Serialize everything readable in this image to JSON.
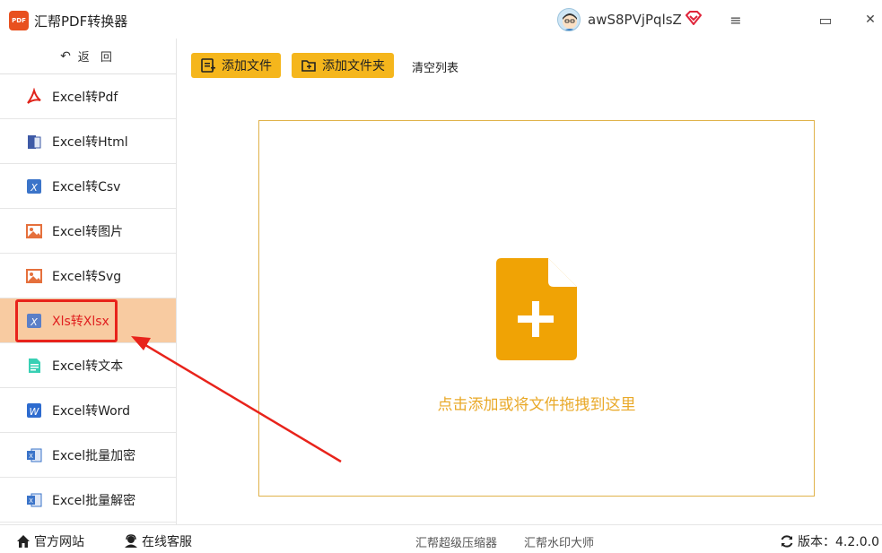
{
  "app": {
    "logo_text": "PDF",
    "title": "汇帮PDF转换器",
    "username": "awS8PVjPqlsZ"
  },
  "window_controls": {
    "menu": "≡",
    "maximize": "▭",
    "close": "✕"
  },
  "sidebar": {
    "back_label": "返 回",
    "items": [
      {
        "label": "Excel转Pdf",
        "icon": "pdf-icon"
      },
      {
        "label": "Excel转Html",
        "icon": "html-icon"
      },
      {
        "label": "Excel转Csv",
        "icon": "csv-icon"
      },
      {
        "label": "Excel转图片",
        "icon": "image-icon"
      },
      {
        "label": "Excel转Svg",
        "icon": "image-icon"
      },
      {
        "label": "Xls转Xlsx",
        "icon": "xls-icon",
        "active": true
      },
      {
        "label": "Excel转文本",
        "icon": "text-icon"
      },
      {
        "label": "Excel转Word",
        "icon": "word-icon"
      },
      {
        "label": "Excel批量加密",
        "icon": "excel-icon"
      },
      {
        "label": "Excel批量解密",
        "icon": "excel-icon"
      }
    ]
  },
  "toolbar": {
    "add_file": "添加文件",
    "add_folder": "添加文件夹",
    "clear_list": "清空列表"
  },
  "dropzone": {
    "hint": "点击添加或将文件拖拽到这里"
  },
  "footer": {
    "official_site": "官方网站",
    "online_service": "在线客服",
    "compressor": "汇帮超级压缩器",
    "watermark": "汇帮水印大师",
    "version_label": "版本：4.2.0.0"
  },
  "colors": {
    "accent": "#f5b61c",
    "active_bg": "#f8cba1",
    "active_text": "#e02020",
    "annotation_red": "#e8231b"
  }
}
